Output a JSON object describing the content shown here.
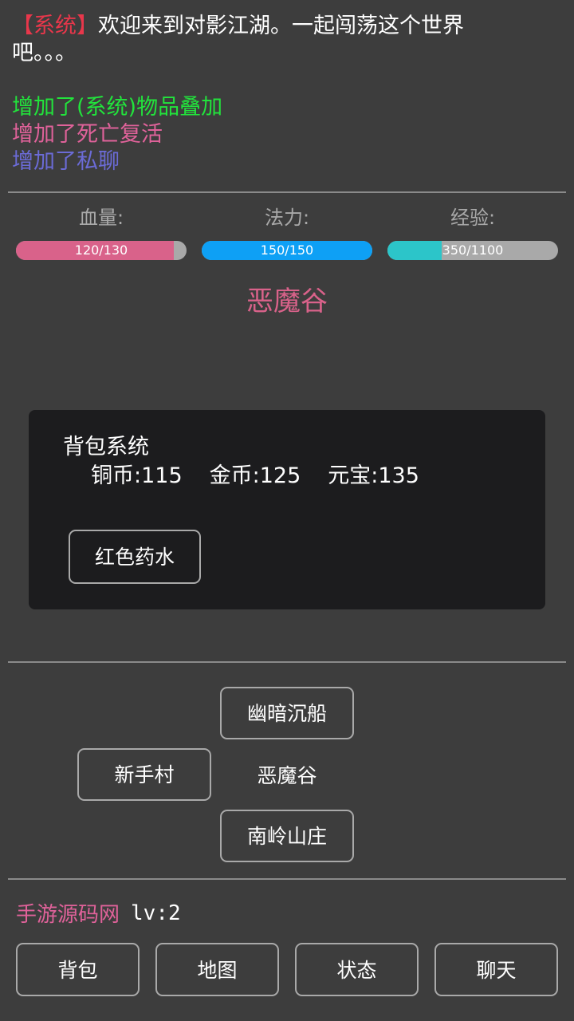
{
  "log": {
    "system_tag": "【系统】",
    "welcome": "欢迎来到对影江湖。一起闯荡这个世界吧。。。",
    "events": [
      {
        "text": "增加了(系统)物品叠加",
        "color": "#22e33c"
      },
      {
        "text": "增加了死亡复活",
        "color": "#e0629a"
      },
      {
        "text": "增加了私聊",
        "color": "#6b6bd6"
      }
    ]
  },
  "stats": {
    "hp": {
      "label": "血量:",
      "current": 120,
      "max": 130,
      "text": "120/130",
      "color": "#d9628a"
    },
    "mp": {
      "label": "法力:",
      "current": 150,
      "max": 150,
      "text": "150/150",
      "color": "#0ea0f5"
    },
    "exp": {
      "label": "经验:",
      "current": 350,
      "max": 1100,
      "text": "350/1100",
      "color": "#2cc5c9"
    }
  },
  "location": {
    "name": "恶魔谷"
  },
  "bag": {
    "title": "背包系统",
    "copper": "铜币:115",
    "gold": "金币:125",
    "ingot": "元宝:135",
    "items": [
      "红色药水"
    ]
  },
  "map": {
    "north": "幽暗沉船",
    "west": "新手村",
    "current": "恶魔谷",
    "south": "南岭山庄"
  },
  "player": {
    "name": "手游源码网",
    "level": "lv:2"
  },
  "nav": {
    "bag": "背包",
    "map": "地图",
    "status": "状态",
    "chat": "聊天"
  }
}
